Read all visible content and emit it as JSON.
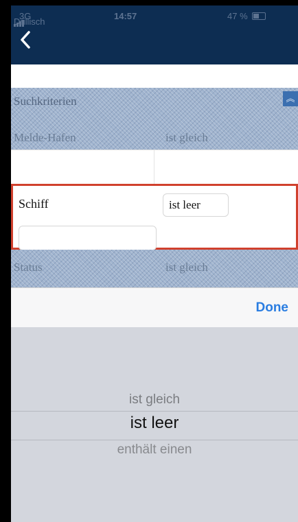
{
  "status_bar": {
    "carrier": "Drillisch",
    "network": "3G",
    "time": "14:57",
    "battery": "47 %"
  },
  "nav": {
    "back_icon": "chevron-left-icon"
  },
  "criteria": {
    "title": "Suchkriterien",
    "collapse_icon": "double-chevron-up-icon",
    "rows": [
      {
        "label": "Melde-Hafen",
        "operator": "ist gleich"
      },
      {
        "label": "Schiff",
        "operator": "ist leer",
        "value": ""
      },
      {
        "label": "Status",
        "operator": "ist gleich"
      }
    ]
  },
  "toolbar": {
    "done_label": "Done"
  },
  "picker": {
    "options": [
      "ist gleich",
      "ist leer",
      "enthält einen"
    ],
    "selected_index": 1
  },
  "colors": {
    "navbar": "#0d2d52",
    "highlight": "#d0402d",
    "accent": "#2a7de1"
  }
}
